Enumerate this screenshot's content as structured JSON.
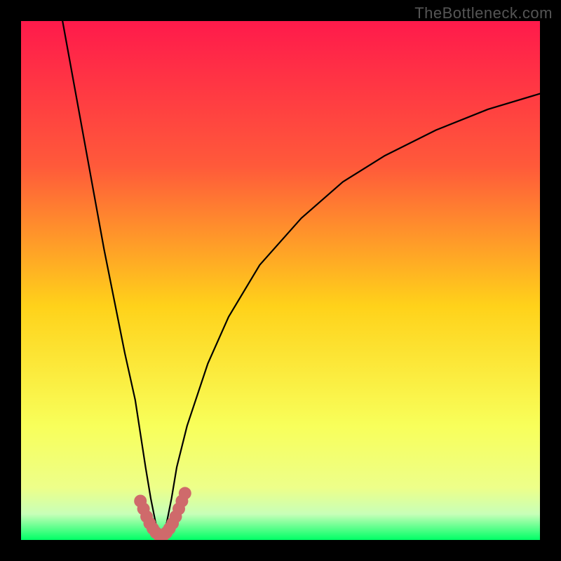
{
  "watermark": "TheBottleneck.com",
  "colors": {
    "black": "#000000",
    "curve": "#000000",
    "marker": "#cf6a6b",
    "grad_top": "#ff1a4b",
    "grad_q1": "#ff5a3a",
    "grad_mid": "#ffd21a",
    "grad_q3": "#f8ff5a",
    "grad_low": "#edff8a",
    "grad_band": "#c8ffb8",
    "grad_bot": "#00ff66"
  },
  "chart_data": {
    "type": "line",
    "title": "",
    "xlabel": "",
    "ylabel": "",
    "xlim": [
      0,
      100
    ],
    "ylim": [
      0,
      100
    ],
    "notch": {
      "x_center": 27,
      "width_at_zero": 6,
      "depth": 0
    },
    "series": [
      {
        "name": "bottleneck-curve",
        "x": [
          8,
          10,
          12,
          14,
          16,
          18,
          20,
          22,
          24,
          25,
          26,
          27,
          28,
          29,
          30,
          32,
          36,
          40,
          46,
          54,
          62,
          70,
          80,
          90,
          100
        ],
        "y": [
          100,
          89,
          78,
          67,
          56,
          46,
          36,
          27,
          14,
          8,
          3,
          0,
          3,
          8,
          14,
          22,
          34,
          43,
          53,
          62,
          69,
          74,
          79,
          83,
          86
        ]
      }
    ],
    "marker_points": {
      "name": "notch-marker",
      "x": [
        23.0,
        23.6,
        24.2,
        24.8,
        25.4,
        26.0,
        26.6,
        27.0,
        27.4,
        28.0,
        28.6,
        29.2,
        29.8,
        30.4,
        31.0,
        31.6
      ],
      "y": [
        7.5,
        6.0,
        4.5,
        3.2,
        2.2,
        1.4,
        0.9,
        0.8,
        0.9,
        1.4,
        2.2,
        3.2,
        4.5,
        6.0,
        7.5,
        9.0
      ]
    }
  }
}
